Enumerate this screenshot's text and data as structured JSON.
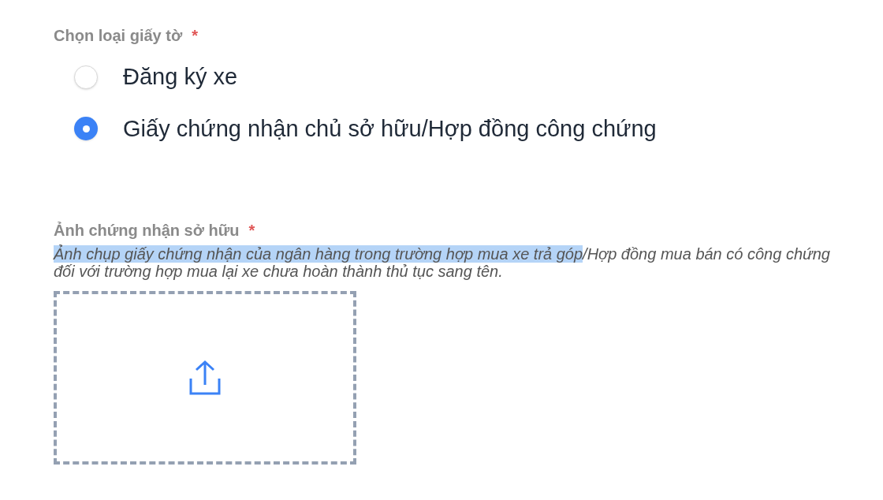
{
  "document_type": {
    "label": "Chọn loại giấy tờ",
    "required_mark": "*",
    "options": [
      {
        "label": "Đăng ký xe",
        "selected": false
      },
      {
        "label": "Giấy chứng nhận chủ sở hữu/Hợp đồng công chứng",
        "selected": true
      }
    ]
  },
  "ownership_photo": {
    "label": "Ảnh chứng nhận sở hữu",
    "required_mark": "*",
    "description": {
      "highlighted": "Ảnh chụp giấy chứng nhận của ngân hàng trong trường hợp mua xe trả góp",
      "rest": "/Hợp đồng mua bán có công chứng đối với trường hợp mua lại xe chưa hoàn thành thủ tục sang tên."
    }
  }
}
